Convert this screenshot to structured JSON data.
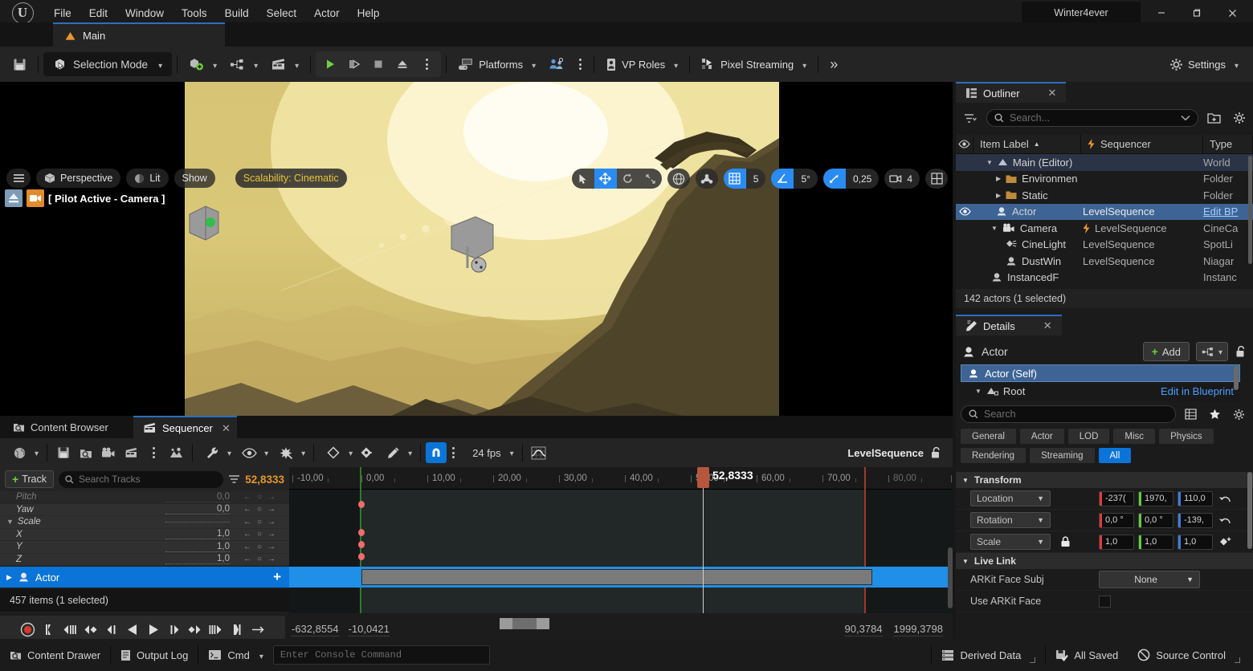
{
  "window": {
    "project_title": "Winter4ever",
    "minimize": "—",
    "maximize": "❐",
    "close": "✕"
  },
  "menubar": {
    "items": [
      "File",
      "Edit",
      "Window",
      "Tools",
      "Build",
      "Select",
      "Actor",
      "Help"
    ]
  },
  "level_tab": {
    "label": "Main"
  },
  "toolbar": {
    "save_icon": "save-icon",
    "mode_label": "Selection Mode",
    "add_icon": "add-actor-icon",
    "blueprint_icon": "blueprints-icon",
    "cinematics_icon": "cinematics-icon",
    "play_icon": "play-icon",
    "skip_icon": "skip-play-icon",
    "stop_icon": "stop-icon",
    "eject_icon": "eject-icon",
    "platforms_label": "Platforms",
    "vproles_label": "VP Roles",
    "pixelstreaming_label": "Pixel Streaming",
    "overflow_label": "»",
    "settings_label": "Settings"
  },
  "viewport": {
    "menu_icon": "viewport-menu-icon",
    "perspective": "Perspective",
    "lit": "Lit",
    "show": "Show",
    "scalability": "Scalability: Cinematic",
    "scalability_color": "#e8c33c",
    "pilot_label": "[ Pilot Active - Camera ]",
    "gizmos": [
      "select-icon",
      "move-icon",
      "rotate-icon",
      "scale-icon"
    ],
    "active_gizmo_index": 1,
    "world_icon": "world-coordinate-icon",
    "surface_snap_icon": "surface-snap-icon",
    "grid_snap_value": "5",
    "angle_snap_value": "5°",
    "scale_snap_value": "0,25",
    "camera_speed_value": "4",
    "layout_icon": "viewport-layout-icon",
    "accent_blue": "#2a8bf2"
  },
  "outliner": {
    "title": "Outliner",
    "close": "✕",
    "search_placeholder": "Search...",
    "columns": [
      "Item Label",
      "Sequencer",
      "Type"
    ],
    "sort_arrow": "▲",
    "rows": [
      {
        "label": "Main (Editor)",
        "sequencer": "",
        "type": "World",
        "depth": 1,
        "expander": "▼",
        "icon": "world-icon",
        "selected": true,
        "eye": false
      },
      {
        "label": "Environmen",
        "sequencer": "",
        "type": "Folder",
        "depth": 2,
        "expander": "▶",
        "icon": "folder-icon",
        "selected": false,
        "eye": false
      },
      {
        "label": "Static",
        "sequencer": "",
        "type": "Folder",
        "depth": 2,
        "expander": "▶",
        "icon": "folder-icon",
        "selected": false,
        "eye": false
      },
      {
        "label": "Actor",
        "sequencer": "LevelSequence",
        "type": "Edit BP",
        "depth": 2,
        "expander": "",
        "icon": "actor-icon",
        "selected": true,
        "eye": true
      },
      {
        "label": "Camera",
        "sequencer": "LevelSequence",
        "type": "CineCa",
        "depth": 2,
        "expander": "▼",
        "icon": "camera-icon",
        "selected": false,
        "eye": false,
        "bolt": true
      },
      {
        "label": "CineLight",
        "sequencer": "LevelSequence",
        "type": "SpotLi",
        "depth": 3,
        "expander": "",
        "icon": "light-icon",
        "selected": false,
        "eye": false
      },
      {
        "label": "DustWin",
        "sequencer": "LevelSequence",
        "type": "Niagar",
        "depth": 3,
        "expander": "",
        "icon": "niagara-icon",
        "selected": false,
        "eye": false
      },
      {
        "label": "InstancedF",
        "sequencer": "",
        "type": "Instanc",
        "depth": 2,
        "expander": "",
        "icon": "actor-icon",
        "selected": false,
        "eye": false
      }
    ],
    "status": "142 actors (1 selected)"
  },
  "details": {
    "title": "Details",
    "close": "✕",
    "object_name": "Actor",
    "add_label": "Add",
    "component_selected": "Actor (Self)",
    "component_root": "Root",
    "edit_in_blueprint": "Edit in Blueprint",
    "search_placeholder": "Search",
    "filters": [
      "General",
      "Actor",
      "LOD",
      "Misc",
      "Physics",
      "Rendering",
      "Streaming",
      "All"
    ],
    "active_filter": "All",
    "sections": [
      {
        "name": "Transform",
        "rows": [
          {
            "label": "Location",
            "type": "vector",
            "dropdown": "Location",
            "values": [
              "-237(",
              "1970,",
              "110,0"
            ],
            "reset": true
          },
          {
            "label": "Rotation",
            "type": "vector",
            "dropdown": "Rotation",
            "values": [
              "0,0 °",
              "0,0 °",
              "-139,"
            ],
            "reset": true
          },
          {
            "label": "Scale",
            "type": "vector",
            "dropdown": "Scale",
            "values": [
              "1,0",
              "1,0",
              "1,0"
            ],
            "lock": true
          }
        ]
      },
      {
        "name": "Live Link",
        "rows": [
          {
            "label": "ARKit Face Subj",
            "type": "combo",
            "value": "None"
          },
          {
            "label": "Use ARKit Face",
            "type": "checkbox",
            "value": ""
          }
        ]
      }
    ],
    "axis_colors": [
      "#e03b3b",
      "#5bd13b",
      "#3b7fe0"
    ]
  },
  "sequencer": {
    "tab_content_browser": "Content Browser",
    "tab_sequencer": "Sequencer",
    "tab_close": "✕",
    "toolbar_icons": [
      "world-icon",
      "save-icon",
      "find-icon",
      "camera-icon",
      "cinematics-icon",
      "kebab-icon",
      "actions-icon",
      "wrench-icon",
      "eye-icon",
      "keying-icon",
      "key-icon",
      "key-interp-icon",
      "curve-icon"
    ],
    "snap_icon": "magnet-icon",
    "fps_label": "24 fps",
    "curve_icon": "curve-editor-icon",
    "sequence_name": "LevelSequence",
    "lock_icon": "unlock-icon",
    "add_track_label": "Track",
    "search_tracks_placeholder": "Search Tracks",
    "current_time": "52,8333",
    "playhead_label": "52,8333",
    "tracks": [
      {
        "name": "Pitch",
        "value": "0,0"
      },
      {
        "name": "Yaw",
        "value": "0,0"
      },
      {
        "name": "Scale",
        "value": "",
        "group": true
      },
      {
        "name": "X",
        "value": "1,0"
      },
      {
        "name": "Y",
        "value": "1,0"
      },
      {
        "name": "Z",
        "value": "1,0"
      }
    ],
    "selected_track": "Actor",
    "track_count": "457 items (1 selected)",
    "ruler_ticks": [
      "-10,00",
      "0,00",
      "10,00",
      "20,00",
      "30,00",
      "40,00",
      "50,00",
      "60,00",
      "70,00",
      "80,00"
    ],
    "range_start": "-632,8554",
    "range_in": "-10,0421",
    "range_out": "90,3784",
    "range_end": "1999,3798",
    "transport_icons": [
      "record-icon",
      "jump-to-start-icon",
      "previous-key-icon",
      "step-back-key-icon",
      "step-back-icon",
      "play-reverse-icon",
      "play-forward-icon",
      "step-forward-icon",
      "next-key-icon",
      "step-forward-key-icon",
      "jump-to-end-icon",
      "loop-icon",
      "forward-icon"
    ],
    "selected_color": "#0b74d8"
  },
  "statusbar": {
    "content_drawer": "Content Drawer",
    "output_log": "Output Log",
    "cmd_label": "Cmd",
    "console_placeholder": "Enter Console Command",
    "derived_data": "Derived Data",
    "all_saved": "All Saved",
    "source_control": "Source Control"
  }
}
